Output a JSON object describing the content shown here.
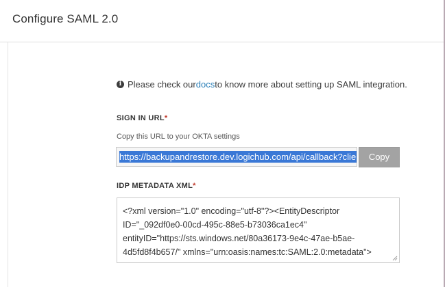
{
  "header": {
    "title": "Configure SAML 2.0"
  },
  "info": {
    "icon": "info-circle-icon",
    "prefix": "Please check our ",
    "link_text": "docs",
    "suffix": " to know more about setting up SAML integration."
  },
  "sign_in": {
    "label": "SIGN IN URL",
    "required_mark": "*",
    "help": "Copy this URL to your OKTA settings",
    "url_value": "https://backupandrestore.dev.logichub.com/api/callback?clien",
    "copy_label": "Copy"
  },
  "idp": {
    "label": "IDP METADATA XML",
    "required_mark": "*",
    "xml_lines": [
      "<?xml version=\"1.0\" encoding=\"utf-8\"?><EntityDescriptor",
      "ID=\"_092df0e0-00cd-495c-88e5-b73036ca1ec4\"",
      "entityID=\"https://sts.windows.net/80a36173-9e4c-47ae-b5ae-",
      "4d5fd8f4b657/\" xmlns=\"urn:oasis:names:tc:SAML:2.0:metadata\">"
    ]
  },
  "colors": {
    "link": "#2a7fb8",
    "required": "#c0392b",
    "selection": "#3a78d6",
    "copy_button": "#a3a3a3"
  }
}
